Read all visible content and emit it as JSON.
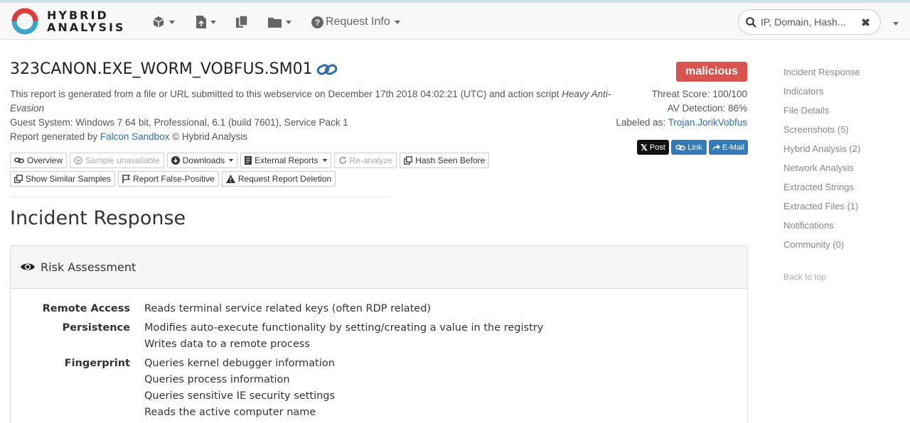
{
  "brand": {
    "line1": "HYBRID",
    "line2": "ANALYSIS"
  },
  "nav": {
    "request_info": "Request Info",
    "search_placeholder": "IP, Domain, Hash...",
    "clear_glyph": "✖"
  },
  "report": {
    "title": "323CANON.EXE_WORM_VOBFUS.SM01",
    "verdict": "malicious",
    "verdict_color": "#d9534f",
    "info_line1": "This report is generated from a file or URL submitted to this webservice on December 17th 2018 04:02:21 (UTC) and action script",
    "action_script_part1": "Heavy Anti-",
    "action_script_part2": "Evasion",
    "guest_system": "Guest System: Windows 7 64 bit, Professional, 6.1 (build 7601), Service Pack 1",
    "generated_by_prefix": "Report generated by",
    "generated_by_link": "Falcon Sandbox",
    "generated_by_suffix": "© Hybrid Analysis",
    "threat_score": "Threat Score: 100/100",
    "av_detection": "AV Detection: 86%",
    "labeled_as_prefix": "Labeled as:",
    "labeled_as_value": "Trojan.JorikVobfus"
  },
  "share": {
    "post": "Post",
    "link": "Link",
    "email": "E-Mail"
  },
  "actions": {
    "overview": "Overview",
    "sample_unavailable": "Sample unavailable",
    "downloads": "Downloads",
    "external_reports": "External Reports",
    "reanalyze": "Re-analyze",
    "hash_seen_before": "Hash Seen Before",
    "show_similar": "Show Similar Samples",
    "report_false_positive": "Report False-Positive",
    "request_deletion": "Request Report Deletion"
  },
  "incident": {
    "heading": "Incident Response",
    "panel_title": "Risk Assessment",
    "rows": [
      {
        "category": "Remote Access",
        "items": [
          "Reads terminal service related keys (often RDP related)"
        ]
      },
      {
        "category": "Persistence",
        "items": [
          "Modifies auto-execute functionality by setting/creating a value in the registry",
          "Writes data to a remote process"
        ]
      },
      {
        "category": "Fingerprint",
        "items": [
          "Queries kernel debugger information",
          "Queries process information",
          "Queries sensitive IE security settings",
          "Reads the active computer name"
        ]
      }
    ]
  },
  "sidenav": {
    "items": [
      "Incident Response",
      "Indicators",
      "File Details",
      "Screenshots (5)",
      "Hybrid Analysis (2)",
      "Network Analysis",
      "Extracted Strings",
      "Extracted Files (1)",
      "Notifications",
      "Community (0)"
    ],
    "back_to_top": "Back to top"
  }
}
